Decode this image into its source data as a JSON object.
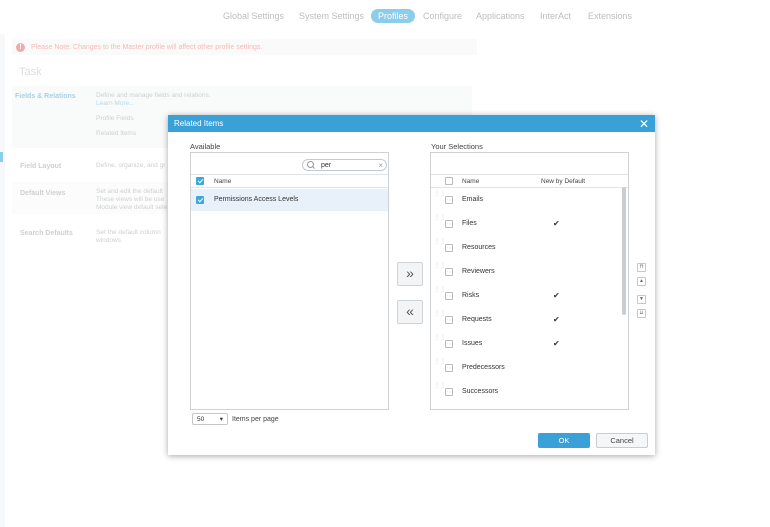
{
  "nav": {
    "items": [
      "Global Settings",
      "System Settings",
      "Profiles",
      "Configure",
      "Applications",
      "InterAct",
      "Extensions"
    ],
    "active": "Profiles"
  },
  "notice": {
    "text": "Please Note: Changes to the Master profile will affect other profile settings."
  },
  "task": {
    "title": "Task"
  },
  "sections": {
    "fields_relations": {
      "label": "Fields & Relations",
      "desc": "Define and manage fields and relations.",
      "link": "Learn More...",
      "sub1": "Profile Fields",
      "sub2": "Related Items"
    },
    "field_layout": {
      "label": "Field Layout",
      "desc": "Define, organize, and gr"
    },
    "default_views": {
      "label": "Default Views",
      "desc": "Set and edit the default\nThese views will be use\nModule view default sele"
    },
    "search_defaults": {
      "label": "Search Defaults",
      "desc": "Set the default column\nwindows."
    }
  },
  "modal": {
    "title": "Related Items",
    "available_label": "Available",
    "selections_label": "Your Selections",
    "search_value": "per",
    "available_header": "Name",
    "available_items": [
      {
        "name": "Permissions Access Levels",
        "checked": true
      }
    ],
    "selections_header_name": "Name",
    "selections_header_default": "New by Default",
    "selections": [
      {
        "name": "Emails",
        "new_by_default": false
      },
      {
        "name": "Files",
        "new_by_default": true
      },
      {
        "name": "Resources",
        "new_by_default": false
      },
      {
        "name": "Reviewers",
        "new_by_default": false
      },
      {
        "name": "Risks",
        "new_by_default": true
      },
      {
        "name": "Requests",
        "new_by_default": true
      },
      {
        "name": "Issues",
        "new_by_default": true
      },
      {
        "name": "Predecessors",
        "new_by_default": false
      },
      {
        "name": "Successors",
        "new_by_default": false
      }
    ],
    "add_glyph": "»",
    "remove_glyph": "«",
    "per_page_value": "50",
    "per_page_label": "Items per page",
    "ok_label": "OK",
    "cancel_label": "Cancel"
  },
  "colors": {
    "accent": "#3ca9de",
    "header": "#3aa0d8",
    "notice": "#e86b6b"
  }
}
